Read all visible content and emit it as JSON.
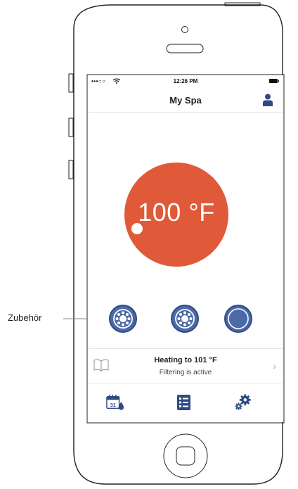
{
  "status_bar": {
    "signal": "•••○○",
    "time": "12:26 PM"
  },
  "header": {
    "title": "My Spa"
  },
  "temperature": {
    "current": "100 °F",
    "dial_color": "#e05a3a"
  },
  "accessories": {
    "callout_label": "Zubehör",
    "buttons": [
      {
        "icon": "jet-pump-icon"
      },
      {
        "icon": "jet-pump-icon"
      },
      {
        "icon": "light-icon"
      }
    ],
    "color": "#4c6aa6"
  },
  "status": {
    "title": "Heating to 101 °F",
    "subtitle": "Filtering is active",
    "chevron": "›"
  },
  "tabs": [
    {
      "icon": "calendar-drop-icon",
      "calendar_day": "31"
    },
    {
      "icon": "list-icon"
    },
    {
      "icon": "settings-gears-icon"
    }
  ]
}
